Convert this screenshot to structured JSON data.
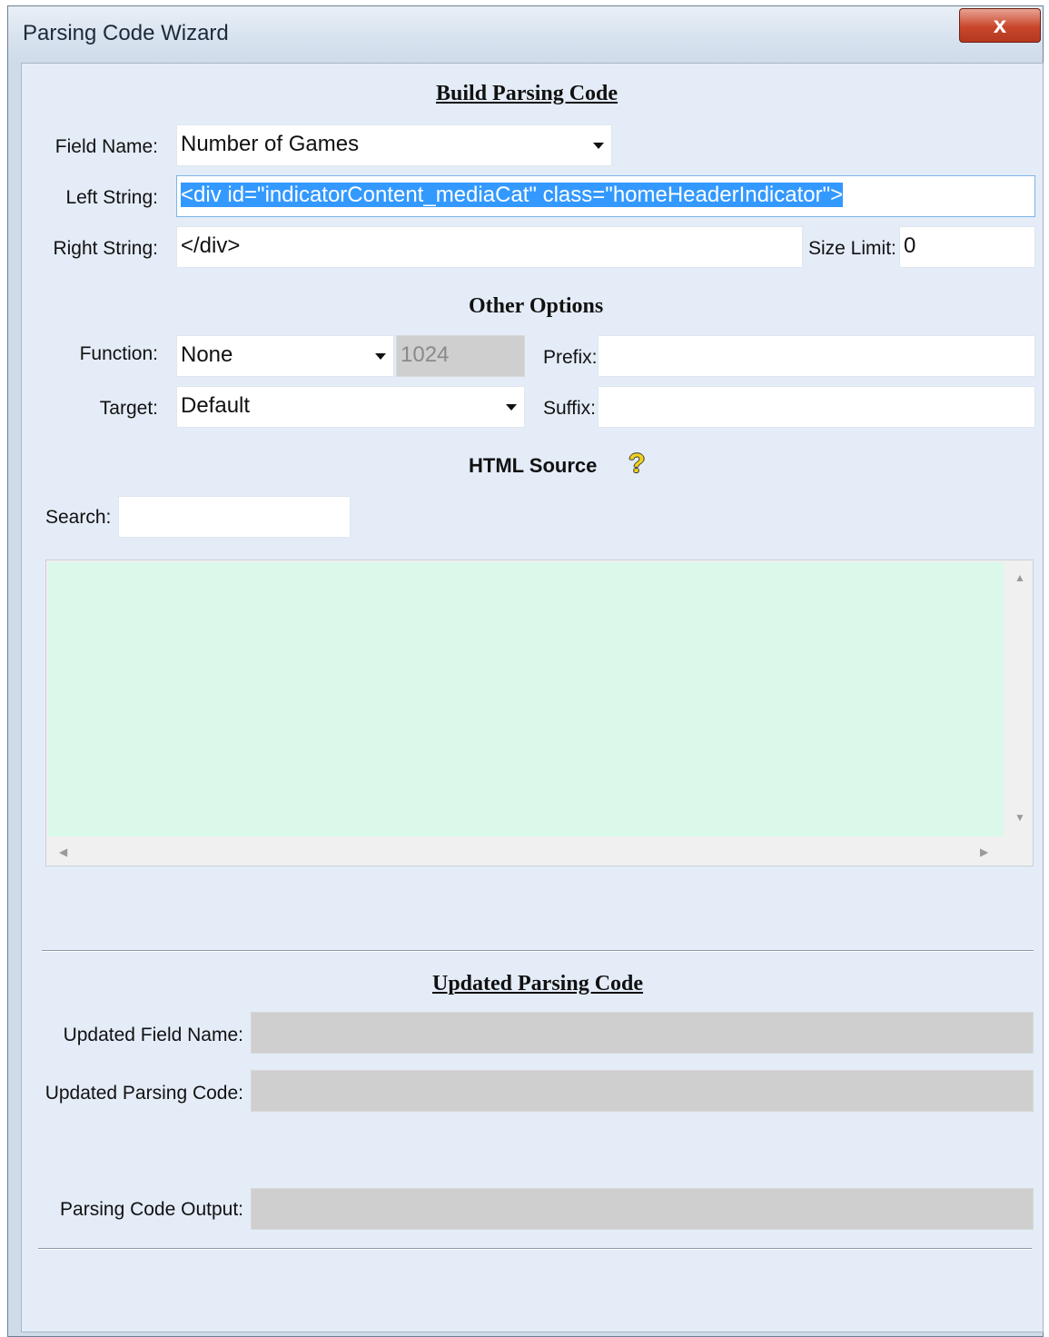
{
  "window": {
    "title": "Parsing Code Wizard",
    "close_glyph": "x"
  },
  "build": {
    "heading": "Build Parsing Code",
    "field_name_label": "Field Name:",
    "field_name_value": "Number of Games",
    "left_string_label": "Left String:",
    "left_string_value": "<div id=\"indicatorContent_mediaCat\" class=\"homeHeaderIndicator\">",
    "right_string_label": "Right String:",
    "right_string_value": "</div>",
    "size_limit_label": "Size Limit:",
    "size_limit_value": "0"
  },
  "options": {
    "heading": "Other Options",
    "function_label": "Function:",
    "function_value": "None",
    "function_param": "1024",
    "prefix_label": "Prefix:",
    "prefix_value": "",
    "target_label": "Target:",
    "target_value": "Default",
    "suffix_label": "Suffix:",
    "suffix_value": ""
  },
  "source": {
    "heading": "HTML Source",
    "help_icon": "?",
    "search_label": "Search:",
    "search_value": "",
    "content": ""
  },
  "updated": {
    "heading": "Updated Parsing Code",
    "field_name_label": "Updated Field Name:",
    "field_name_value": "",
    "parsing_code_label": "Updated Parsing Code:",
    "parsing_code_value": "",
    "output_label": "Parsing Code Output:",
    "output_value": ""
  },
  "colors": {
    "source_bg": "#daf9eb",
    "selection": "#3399ff",
    "disabled": "#cfcfcf"
  }
}
